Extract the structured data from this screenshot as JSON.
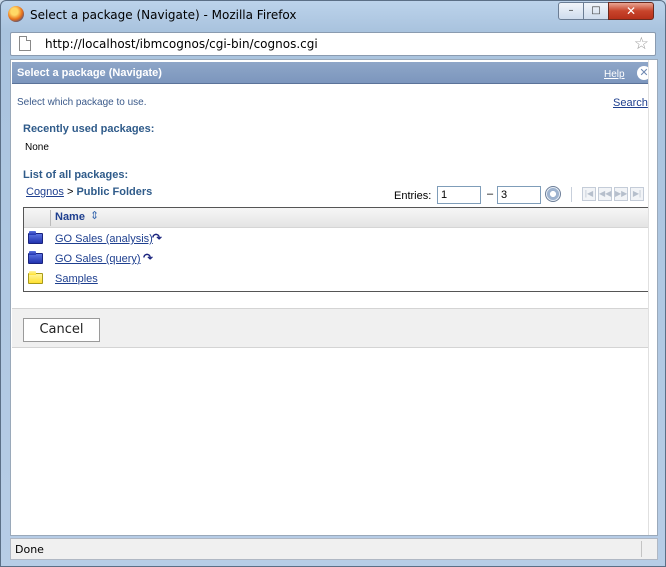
{
  "window": {
    "title": "Select a package (Navigate) - Mozilla Firefox",
    "minimize_glyph": "–",
    "maximize_glyph": "□",
    "close_glyph": "✕"
  },
  "urlbar": {
    "url": "http://localhost/ibmcognos/cgi-bin/cognos.cgi"
  },
  "dialog": {
    "title": "Select a package (Navigate)",
    "help_label": "Help",
    "instruction": "Select which package to use.",
    "search_label": "Search",
    "recent_label": "Recently used packages:",
    "recent_value": "None",
    "list_label": "List of all packages:",
    "breadcrumb": {
      "root": "Cognos",
      "separator": " > ",
      "current": "Public Folders"
    },
    "entries": {
      "label": "Entries:",
      "from": "1",
      "to": "3",
      "dash": "–"
    },
    "grid": {
      "column_header": "Name",
      "rows": [
        {
          "name": "GO Sales (analysis)",
          "icon": "package-folder-icon",
          "color": "blue",
          "has_run_icon": true
        },
        {
          "name": "GO Sales (query)",
          "icon": "package-folder-icon",
          "color": "blue",
          "has_run_icon": true
        },
        {
          "name": "Samples",
          "icon": "folder-icon",
          "color": "yellow",
          "has_run_icon": false
        }
      ]
    },
    "cancel_label": "Cancel"
  },
  "statusbar": {
    "text": "Done"
  },
  "colors": {
    "header_blue": "#7c96bd",
    "link_blue": "#1e3f8f",
    "label_blue": "#2f5b8a"
  }
}
